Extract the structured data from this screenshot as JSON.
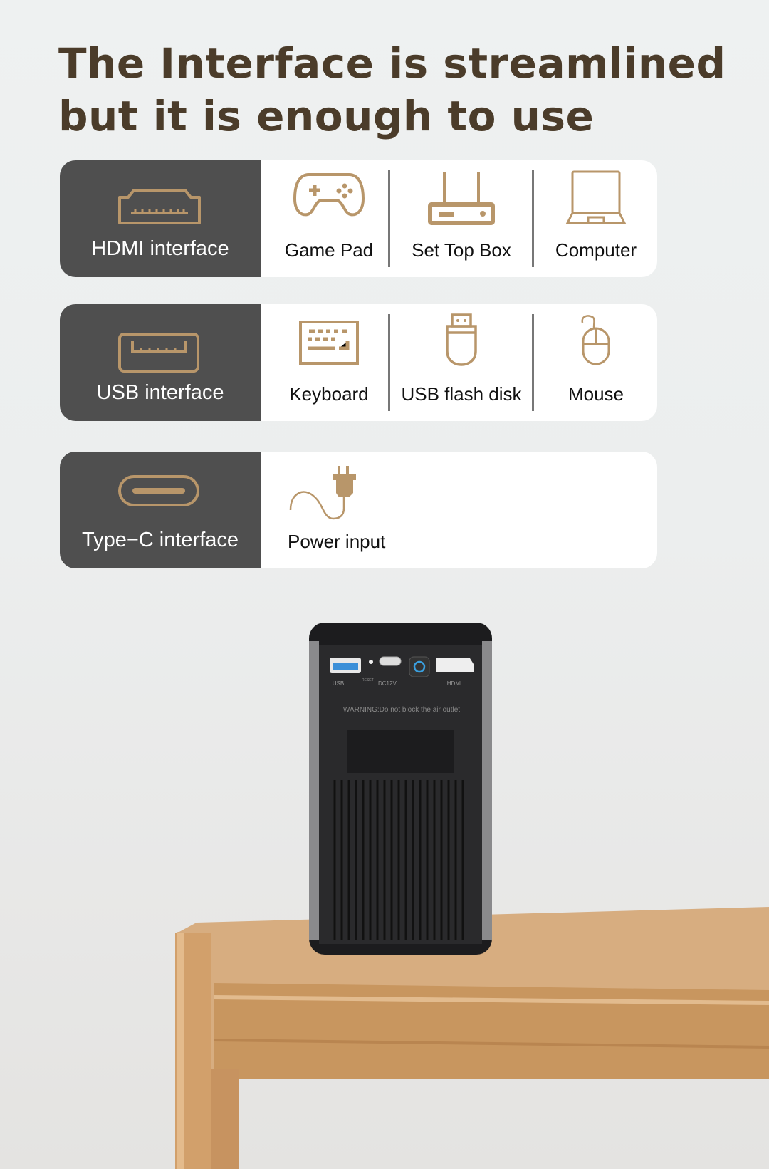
{
  "title": {
    "line1": "The Interface is streamlined",
    "line2": "but it is  enough to use"
  },
  "rows": [
    {
      "interface": "HDMI interface",
      "icon": "hdmi-port-icon",
      "items": [
        {
          "label": "Game Pad",
          "icon": "gamepad-icon"
        },
        {
          "label": "Set Top Box",
          "icon": "set-top-box-icon"
        },
        {
          "label": "Computer",
          "icon": "laptop-icon"
        }
      ]
    },
    {
      "interface": "USB interface",
      "icon": "usb-port-icon",
      "items": [
        {
          "label": "Keyboard",
          "icon": "keyboard-icon"
        },
        {
          "label": "USB flash disk",
          "icon": "usb-flash-disk-icon"
        },
        {
          "label": "Mouse",
          "icon": "mouse-icon"
        }
      ]
    },
    {
      "interface": "Type−C interface",
      "icon": "type-c-port-icon",
      "items": [
        {
          "label": "Power input",
          "icon": "power-plug-icon"
        }
      ]
    }
  ],
  "projector": {
    "usb": "USB",
    "reset": "RESET",
    "dc": "DC12V",
    "hdmi": "HDMI",
    "warning": "WARNING:Do not block the air outlet"
  },
  "colors": {
    "accent": "#b8966a",
    "panel_dark": "#4f4f4f",
    "title": "#4b3c2a"
  }
}
